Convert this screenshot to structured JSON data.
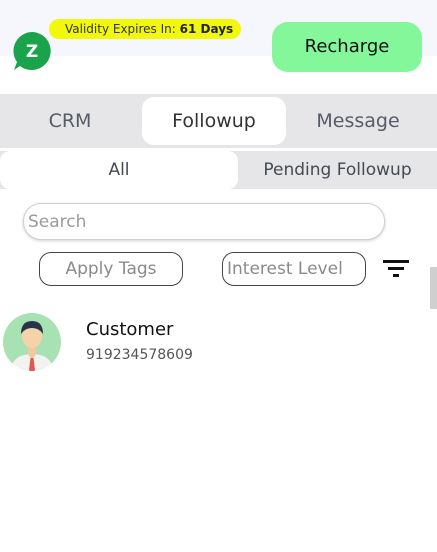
{
  "header": {
    "validity_prefix": "Validity Expires In:",
    "validity_value": "61 Days",
    "recharge_label": "Recharge",
    "logo_letter": "Z"
  },
  "tabs": [
    {
      "label": "CRM",
      "active": false
    },
    {
      "label": "Followup",
      "active": true
    },
    {
      "label": "Message",
      "active": false
    }
  ],
  "subtabs": [
    {
      "label": "All",
      "active": true
    },
    {
      "label": "Pending Followup",
      "active": false
    }
  ],
  "search": {
    "placeholder": "Search",
    "value": ""
  },
  "filters": {
    "apply_tags_label": "Apply Tags",
    "interest_level_label": "Interest Level"
  },
  "contacts": [
    {
      "name": "Customer",
      "phone": "919234578609"
    }
  ],
  "colors": {
    "brand_green": "#1aa34a",
    "validity_bg": "#f2f80b",
    "recharge_bg": "#83f79a",
    "tab_bar_bg": "#e6e6e8"
  }
}
